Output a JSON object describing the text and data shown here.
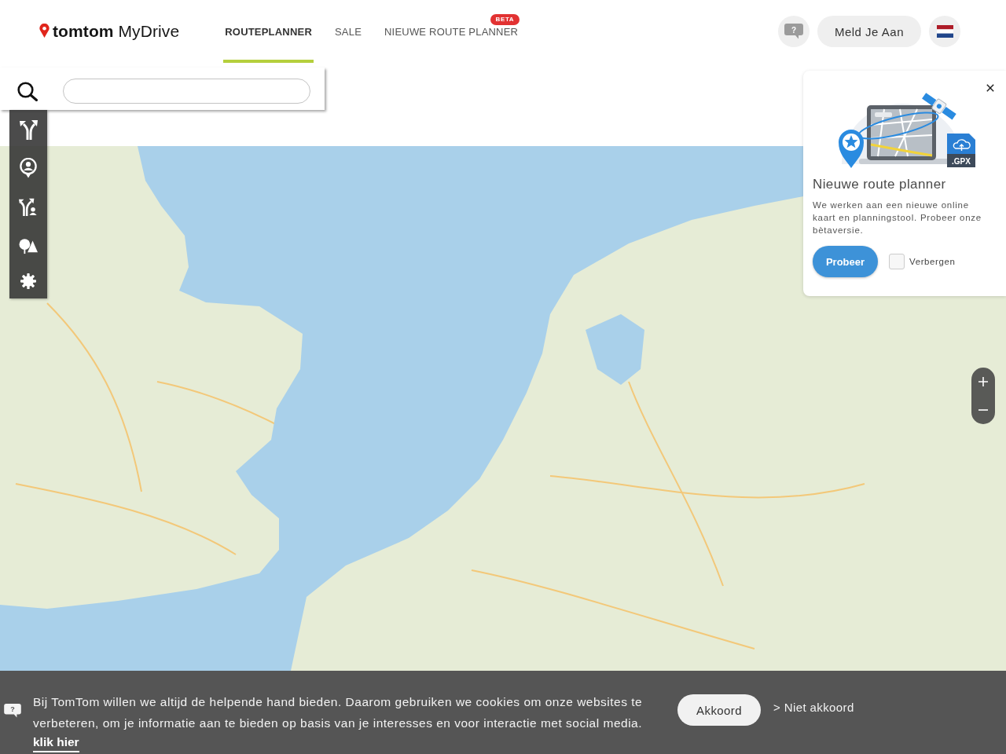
{
  "header": {
    "logo": "**tomtom** MyDrive",
    "nav": [
      {
        "label": "ROUTEPLANNER",
        "selected": true
      },
      {
        "label": "SALE",
        "selected": false
      },
      {
        "label": "NIEUWE ROUTE PLANNER",
        "selected": false,
        "badge": "BETA"
      }
    ],
    "help_button": "?",
    "login_button": "Meld Je Aan"
  },
  "popup": {
    "file_label": ".GPX",
    "title": "Nieuwe route planner",
    "text": "We werken aan een nieuwe online kaart en planningstool. Probeer onze bètaversie.",
    "button": "Probeer",
    "checkbox": {
      "label": "Verbergen",
      "checked": false
    }
  },
  "cookie_bar": {
    "icon_label": "?",
    "text": "Bij TomTom willen we altijd de helpende hand bieden. Daarom gebruiken we cookies om onze websites te verbeteren, om je informatie aan te bieden op basis van je interesses en voor interactie met social media.",
    "link": "klik hier",
    "accept_button": "Akkoord",
    "decline_link": "> Niet akkoord"
  }
}
